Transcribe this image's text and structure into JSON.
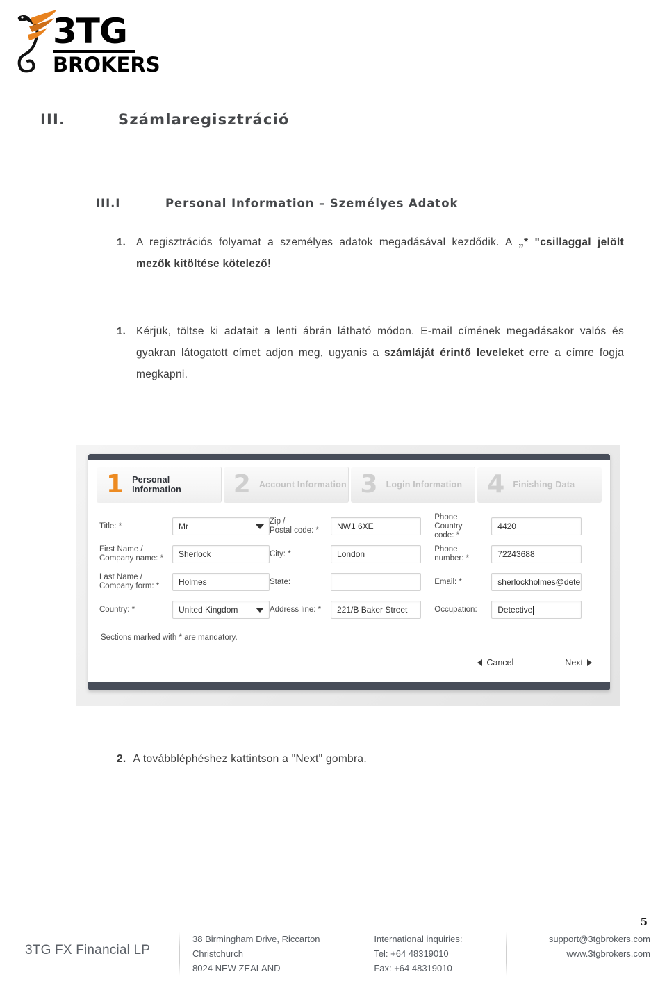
{
  "logo": {
    "brand_top": "3TG",
    "brand_bottom": "BROKERS",
    "icon": "dragon-flame-logo"
  },
  "headings": {
    "section_number": "III.",
    "section_title": "Számlaregisztráció",
    "subsection_number": "III.I",
    "subsection_title": "Personal Information – Személyes Adatok"
  },
  "paragraphs": {
    "p1_marker": "1.",
    "p1_part1": "A regisztrációs folyamat a személyes adatok megadásával kezdődik. A ",
    "p1_part2": "„* \"csillaggal jelölt mezők kitöltése kötelező!",
    "p2_marker": "1.",
    "p2_part1": "Kérjük, töltse ki adatait a lenti ábrán látható módon. E-mail címének megadásakor valós és gyakran látogatott címet adjon meg, ugyanis a ",
    "p2_part2": "számláját érintő leveleket",
    "p2_part3": " erre a címre fogja megkapni.",
    "p3_marker": "2.",
    "p3_text": "A továbbléphéshez kattintson a \"Next\" gombra."
  },
  "screenshot": {
    "steps": [
      {
        "number": "1",
        "label": "Personal Information",
        "state": "active"
      },
      {
        "number": "2",
        "label": "Account Information",
        "state": "idle"
      },
      {
        "number": "3",
        "label": "Login Information",
        "state": "idle"
      },
      {
        "number": "4",
        "label": "Finishing Data",
        "state": "idle"
      }
    ],
    "fields_col1": [
      {
        "label": "Title: *",
        "value": "Mr",
        "type": "select"
      },
      {
        "label": "First Name /\nCompany name: *",
        "value": "Sherlock",
        "type": "text"
      },
      {
        "label": "Last Name /\nCompany form: *",
        "value": "Holmes",
        "type": "text"
      },
      {
        "label": "Country: *",
        "value": "United Kingdom",
        "type": "select"
      }
    ],
    "fields_col2": [
      {
        "label": "Zip /\nPostal code: *",
        "value": "NW1 6XE",
        "type": "text"
      },
      {
        "label": "City: *",
        "value": "London",
        "type": "text"
      },
      {
        "label": "State:",
        "value": "",
        "type": "text"
      },
      {
        "label": "Address line: *",
        "value": "221/B Baker Street",
        "type": "text"
      }
    ],
    "fields_col3": [
      {
        "label": "Phone Country\ncode: *",
        "value": "4420",
        "type": "text"
      },
      {
        "label": "Phone number: *",
        "value": "72243688",
        "type": "text"
      },
      {
        "label": "Email: *",
        "value": "sherlockholmes@dete",
        "type": "text"
      },
      {
        "label": "Occupation:",
        "value": "Detective",
        "type": "text-focused"
      }
    ],
    "mandatory_note": "Sections marked with * are mandatory.",
    "cancel_label": "Cancel",
    "next_label": "Next",
    "accent_color": "#ED8B22",
    "bar_color": "#474d59"
  },
  "footer": {
    "page_number": "5",
    "company": "3TG FX Financial LP",
    "address_line1": "38 Birmingham Drive, Riccarton",
    "address_line2": "Christchurch",
    "address_line3": "8024 NEW ZEALAND",
    "intl_title": "International inquiries:",
    "tel": "Tel:  +64 48319010",
    "fax": "Fax: +64 48319010",
    "email": "support@3tgbrokers.com",
    "website": "www.3tgbrokers.com"
  }
}
